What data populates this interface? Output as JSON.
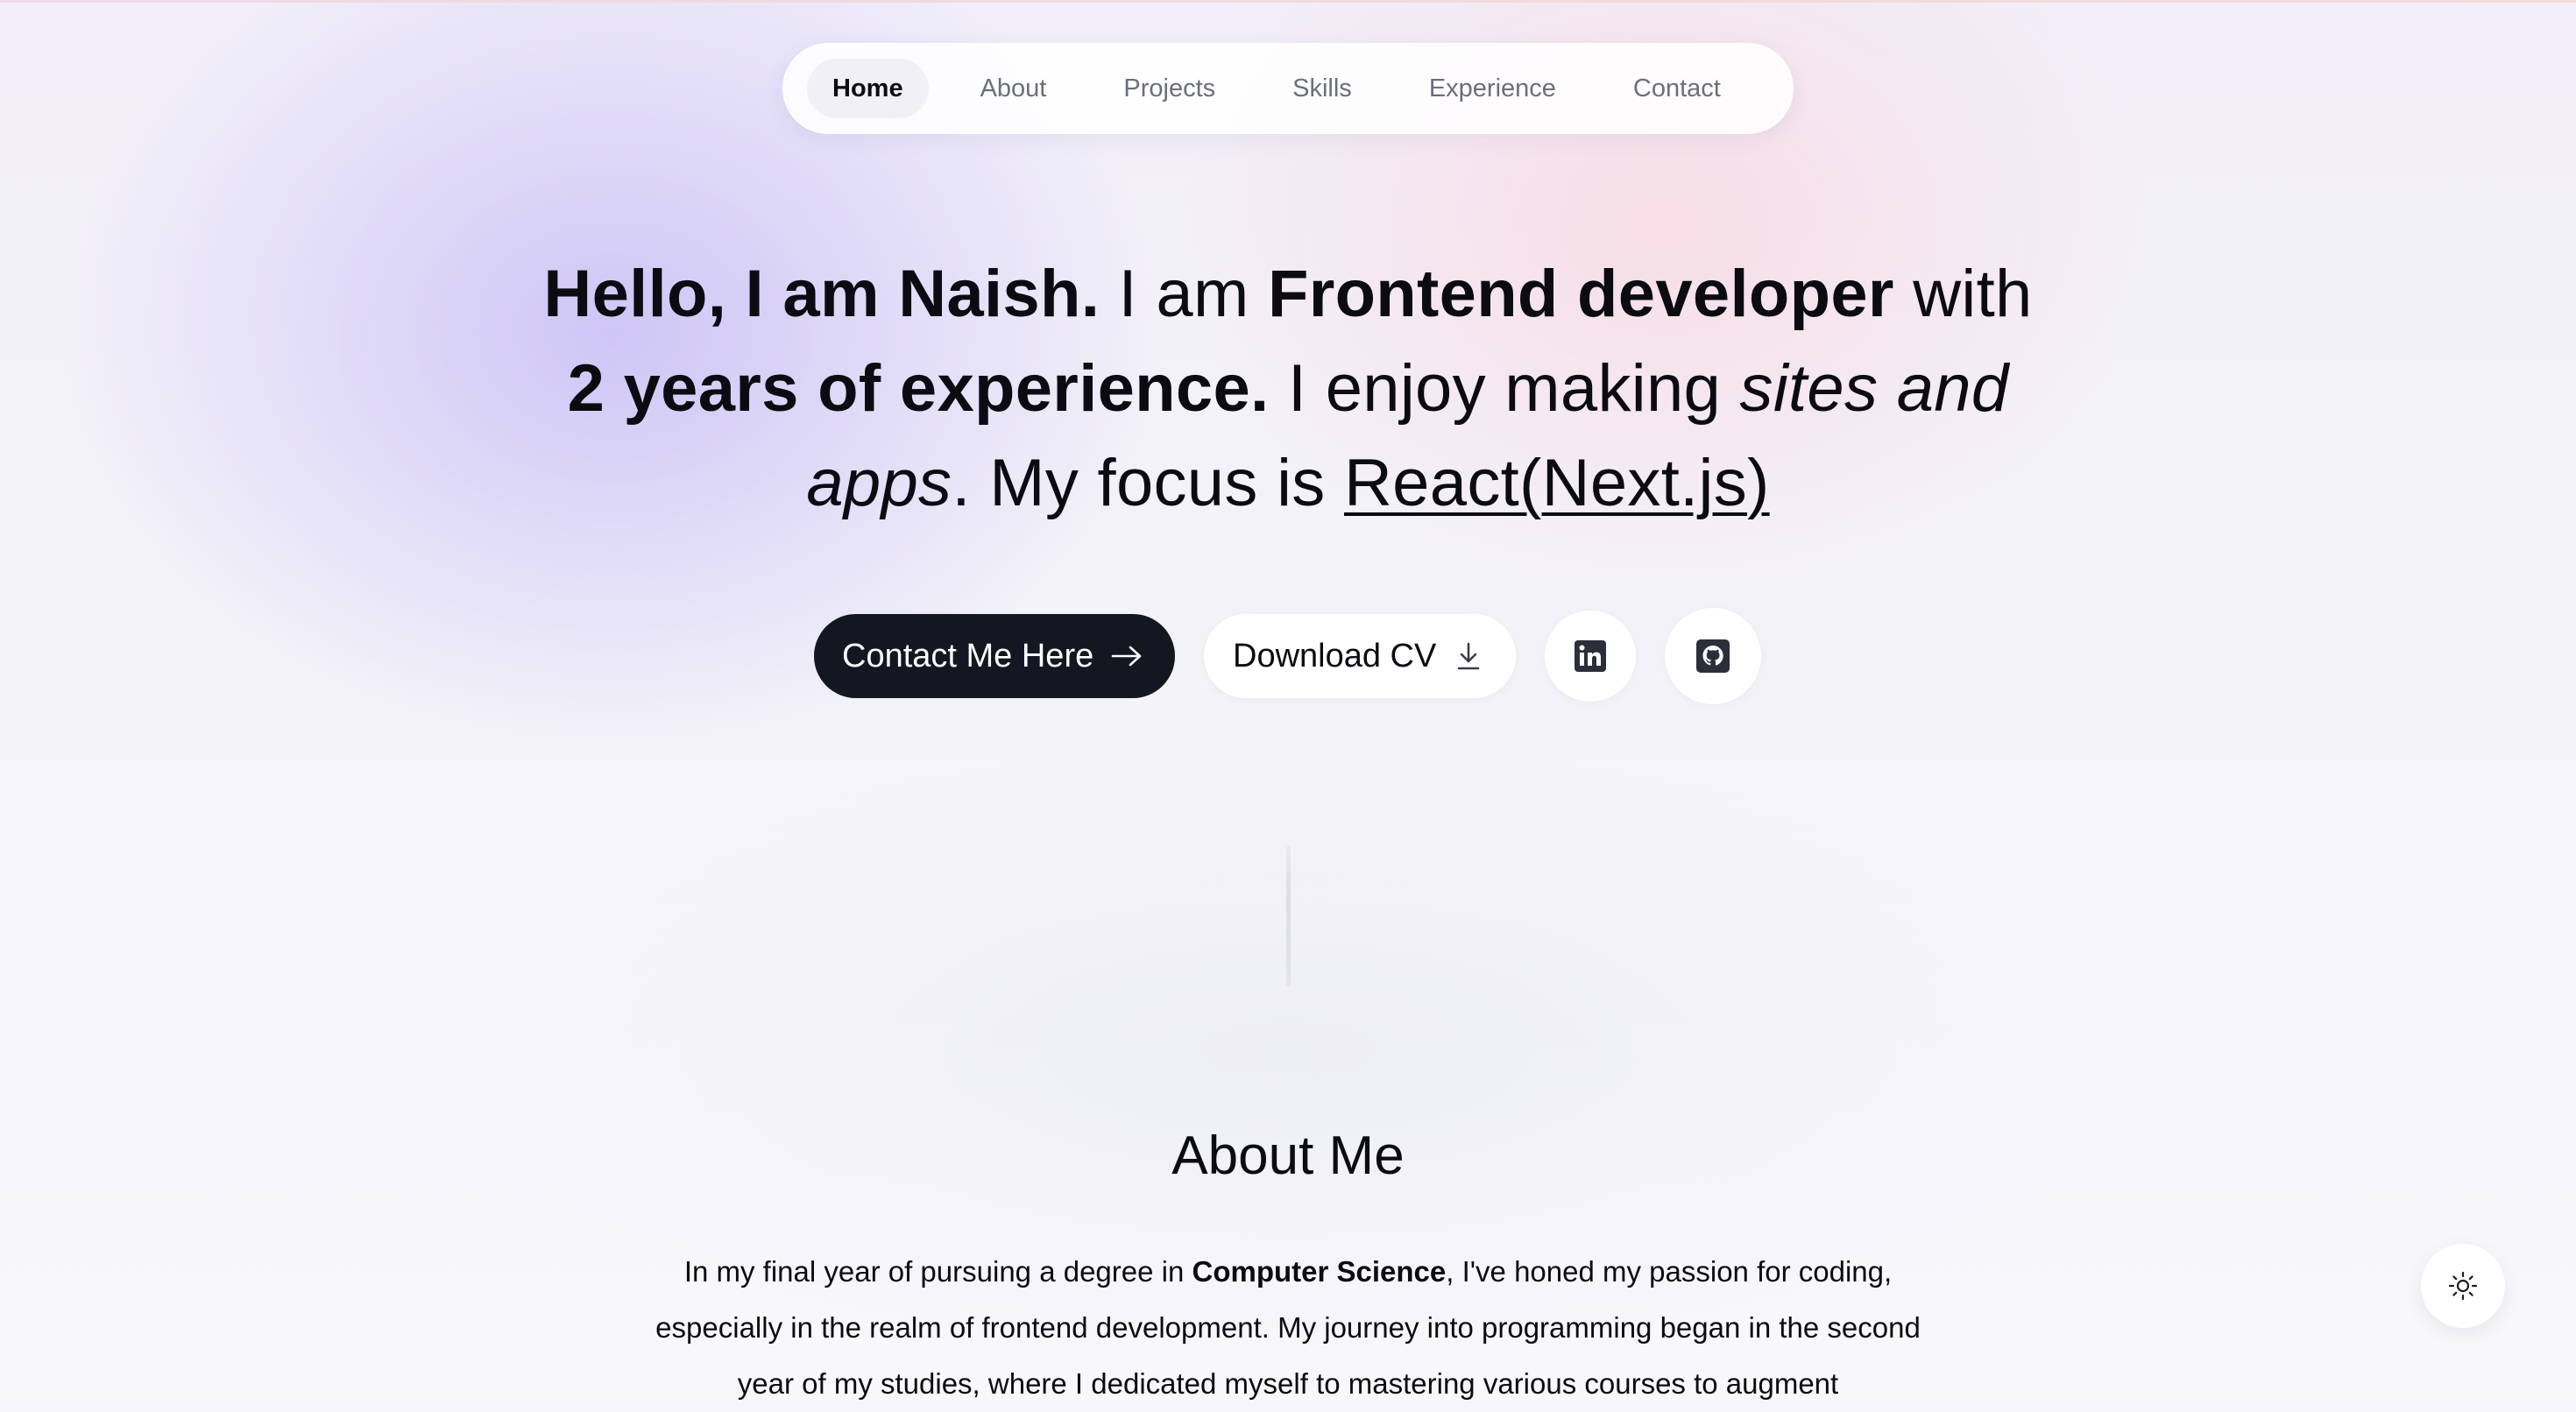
{
  "nav": {
    "items": [
      {
        "label": "Home",
        "active": true
      },
      {
        "label": "About",
        "active": false
      },
      {
        "label": "Projects",
        "active": false
      },
      {
        "label": "Skills",
        "active": false
      },
      {
        "label": "Experience",
        "active": false
      },
      {
        "label": "Contact",
        "active": false
      }
    ]
  },
  "hero": {
    "greeting": "Hello, I am Naish.",
    "i_am": " I am ",
    "role": "Frontend developer",
    "with": " with ",
    "experience": "2 years of experience.",
    "enjoy": " I enjoy making ",
    "making": "sites and apps",
    "focus": ". My focus is ",
    "tech": "React(Next.js)"
  },
  "buttons": {
    "contact_label": "Contact Me Here",
    "contact_icon": "arrow-right-icon",
    "cv_label": "Download CV",
    "cv_icon": "download-icon",
    "linkedin_icon": "linkedin-icon",
    "github_icon": "github-icon"
  },
  "about": {
    "title": "About Me",
    "p1": "In my final year of pursuing a degree in ",
    "p1_bold": "Computer Science",
    "p1_rest": ", I've honed my passion for coding, especially in the realm of frontend development. My journey into programming began in the second year of my studies, where I dedicated myself to mastering various courses to augment"
  },
  "theme_toggle": {
    "icon": "sun-icon"
  },
  "colors": {
    "primary_dark": "#131722",
    "text": "#0b0b12",
    "muted": "#6b6f7b"
  }
}
